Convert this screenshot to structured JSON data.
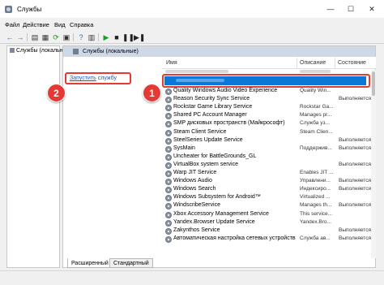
{
  "window": {
    "title": "Службы",
    "min_glyph": "—",
    "max_glyph": "☐",
    "close_glyph": "✕"
  },
  "menu": {
    "items": [
      {
        "label": "Файл",
        "underline": "Ф"
      },
      {
        "label": "Действие",
        "underline": "Д"
      },
      {
        "label": "Вид",
        "underline": "В"
      },
      {
        "label": "Справка",
        "underline": "С"
      }
    ]
  },
  "toolbar": {
    "icons": [
      "back-arrow-icon",
      "forward-arrow-icon",
      "console-tree-icon",
      "properties-icon",
      "refresh-icon",
      "export-icon",
      "help-icon",
      "view-icon",
      "start-icon",
      "stop-icon",
      "pause-icon",
      "restart-icon"
    ]
  },
  "tree": {
    "root_label": "Службы (локальны"
  },
  "pane": {
    "header": "Службы (локальные)",
    "action_link": "Запустить",
    "action_link_suffix": " службу"
  },
  "columns": {
    "name": "Имя",
    "description": "Описание",
    "state": "Состояние"
  },
  "services": [
    {
      "name": "Quality Windows Audio Video Experience",
      "desc": "Quality Win...",
      "state": ""
    },
    {
      "name": "Reason Security Sync Service",
      "desc": "",
      "state": "Выполняется"
    },
    {
      "name": "Rockstar Game Library Service",
      "desc": "Rockstar Ga...",
      "state": ""
    },
    {
      "name": "Shared PC Account Manager",
      "desc": "Manages pr...",
      "state": ""
    },
    {
      "name": "SMP дисковых пространств (Майкрософт)",
      "desc": "Служба уз...",
      "state": ""
    },
    {
      "name": "Steam Client Service",
      "desc": "Steam Clien...",
      "state": ""
    },
    {
      "name": "SteelSeries Update Service",
      "desc": "",
      "state": "Выполняется"
    },
    {
      "name": "SysMain",
      "desc": "Поддержив...",
      "state": "Выполняется"
    },
    {
      "name": "Uncheater for BattleGrounds_GL",
      "desc": "",
      "state": ""
    },
    {
      "name": "VirtualBox system service",
      "desc": "",
      "state": "Выполняется"
    },
    {
      "name": "Warp JIT Service",
      "desc": "Enables JIT ...",
      "state": ""
    },
    {
      "name": "Windows Audio",
      "desc": "Управлени...",
      "state": "Выполняется"
    },
    {
      "name": "Windows Search",
      "desc": "Индексиро...",
      "state": "Выполняется"
    },
    {
      "name": "Windows Subsystem for Android™",
      "desc": "Virtualized ...",
      "state": ""
    },
    {
      "name": "WindscribeService",
      "desc": "Manages th...",
      "state": "Выполняется"
    },
    {
      "name": "Xbox Accessory Management Service",
      "desc": "This service...",
      "state": ""
    },
    {
      "name": "Yandex.Browser Update Service",
      "desc": "Yandex.Bro...",
      "state": ""
    },
    {
      "name": "Zakynthos Service",
      "desc": "",
      "state": "Выполняется"
    },
    {
      "name": "Автоматическая настройка сетевых устройств",
      "desc": "Служба ав...",
      "state": "Выполняется"
    }
  ],
  "tabs": {
    "extended": "Расширенный",
    "standard": "Стандартный"
  },
  "callouts": {
    "one": "1",
    "two": "2"
  },
  "colors": {
    "selection": "#0a78d7",
    "callout_red": "#e53935",
    "pane_header": "#cfd8e6",
    "link": "#1a55c4"
  }
}
